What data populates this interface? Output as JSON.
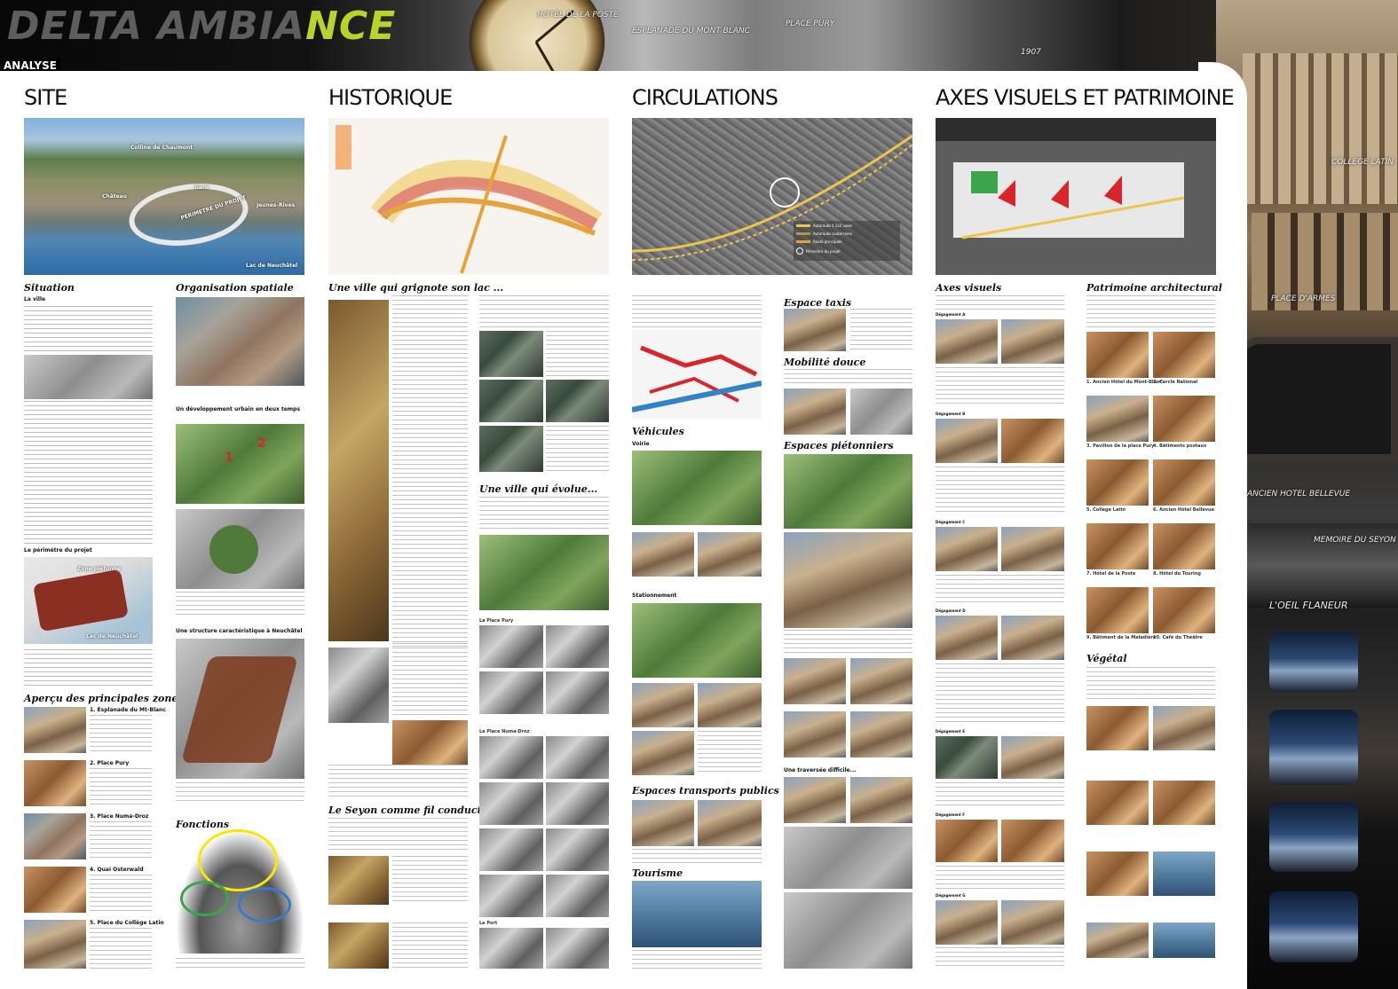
{
  "banner": {
    "logo_part1": "DELTA AMBIA",
    "logo_part2": "NCE",
    "labels": [
      "HOTEL DE LA POSTE",
      "ESPLANADE DU MONT BLANC",
      "PLACE PURY",
      "1907"
    ],
    "tag": "ANALYSE"
  },
  "right_strip": {
    "captions": [
      "COLLEGE LATIN",
      "PLACE D'ARMES",
      "ANCIEN HOTEL BELLEVUE",
      "MEMOIRE DU SEYON",
      "L'OEIL FLANEUR"
    ]
  },
  "columns": {
    "site": {
      "title": "SITE",
      "aerial_labels": [
        "Colline de Chaumont",
        "Château",
        "Gare",
        "Jeunes-Rives",
        "PERIMETRE DU PROJET",
        "Lac de Neuchâtel"
      ],
      "situation_title": "Situation",
      "ville_label": "La ville",
      "perimetre_label": "Le périmètre du projet",
      "apercu_title": "Aperçu des principales zones",
      "zones": [
        "1. Esplanade du Mt-Blanc",
        "2. Place Pury",
        "3. Place Numa-Droz",
        "4. Quai Osterwald",
        "5. Place du Collège Latin"
      ],
      "org_title": "Organisation spatiale",
      "dev_title": "Un développement urbain en deux temps",
      "structure_title": "Une structure caractéristique à Neuchâtel",
      "fonctions_title": "Fonctions",
      "map_labels": [
        "Lac de Neuchâtel",
        "Zone piétonne"
      ]
    },
    "historique": {
      "title": "HISTORIQUE",
      "sub1": "Une ville qui grignote son lac ...",
      "sub2": "Une ville qui évolue...",
      "sub3": "Le Seyon comme fil conducteur",
      "photo_caps": [
        "La Place Pury",
        "La Place Numa-Droz",
        "Le Port"
      ]
    },
    "circulations": {
      "title": "CIRCULATIONS",
      "legend": [
        "Autoroute à 2x2 voies",
        "Autoroute souterraine",
        "Route principale",
        "Périmètre du projet"
      ],
      "vehicules": "Véhicules",
      "voirie": "Voirie",
      "stationnement": "Stationnement",
      "transports": "Espaces transports publics",
      "tourisme": "Tourisme",
      "taxis": "Espace taxis",
      "mobilite": "Mobilité douce",
      "pietons": "Espaces piétonniers",
      "traversee": "Une traversée difficile..."
    },
    "axes": {
      "title": "AXES VISUELS ET PATRIMOINE",
      "axes_title": "Axes visuels",
      "patrimoine_title": "Patrimoine architectural",
      "vegetal_title": "Végétal",
      "degagements": [
        "Dégagement A",
        "Dégagement B",
        "Dégagement C",
        "Dégagement D",
        "Dégagement E",
        "Dégagement F",
        "Dégagement G"
      ],
      "batiments": [
        "1. Ancien Hôtel du Mont-Blanc",
        "2. Cercle National",
        "3. Pavillon de la place Pury",
        "4. Bâtiments postaux",
        "5. Collège Latin",
        "6. Ancien Hôtel Bellevue",
        "7. Hôtel de la Poste",
        "8. Hôtel du Touring",
        "9. Bâtiment de la Maladière",
        "10. Café du Théâtre"
      ]
    }
  },
  "colors": {
    "accent_yellow": "#b9d22c",
    "red": "#d9242a",
    "orange": "#e8a23a"
  }
}
